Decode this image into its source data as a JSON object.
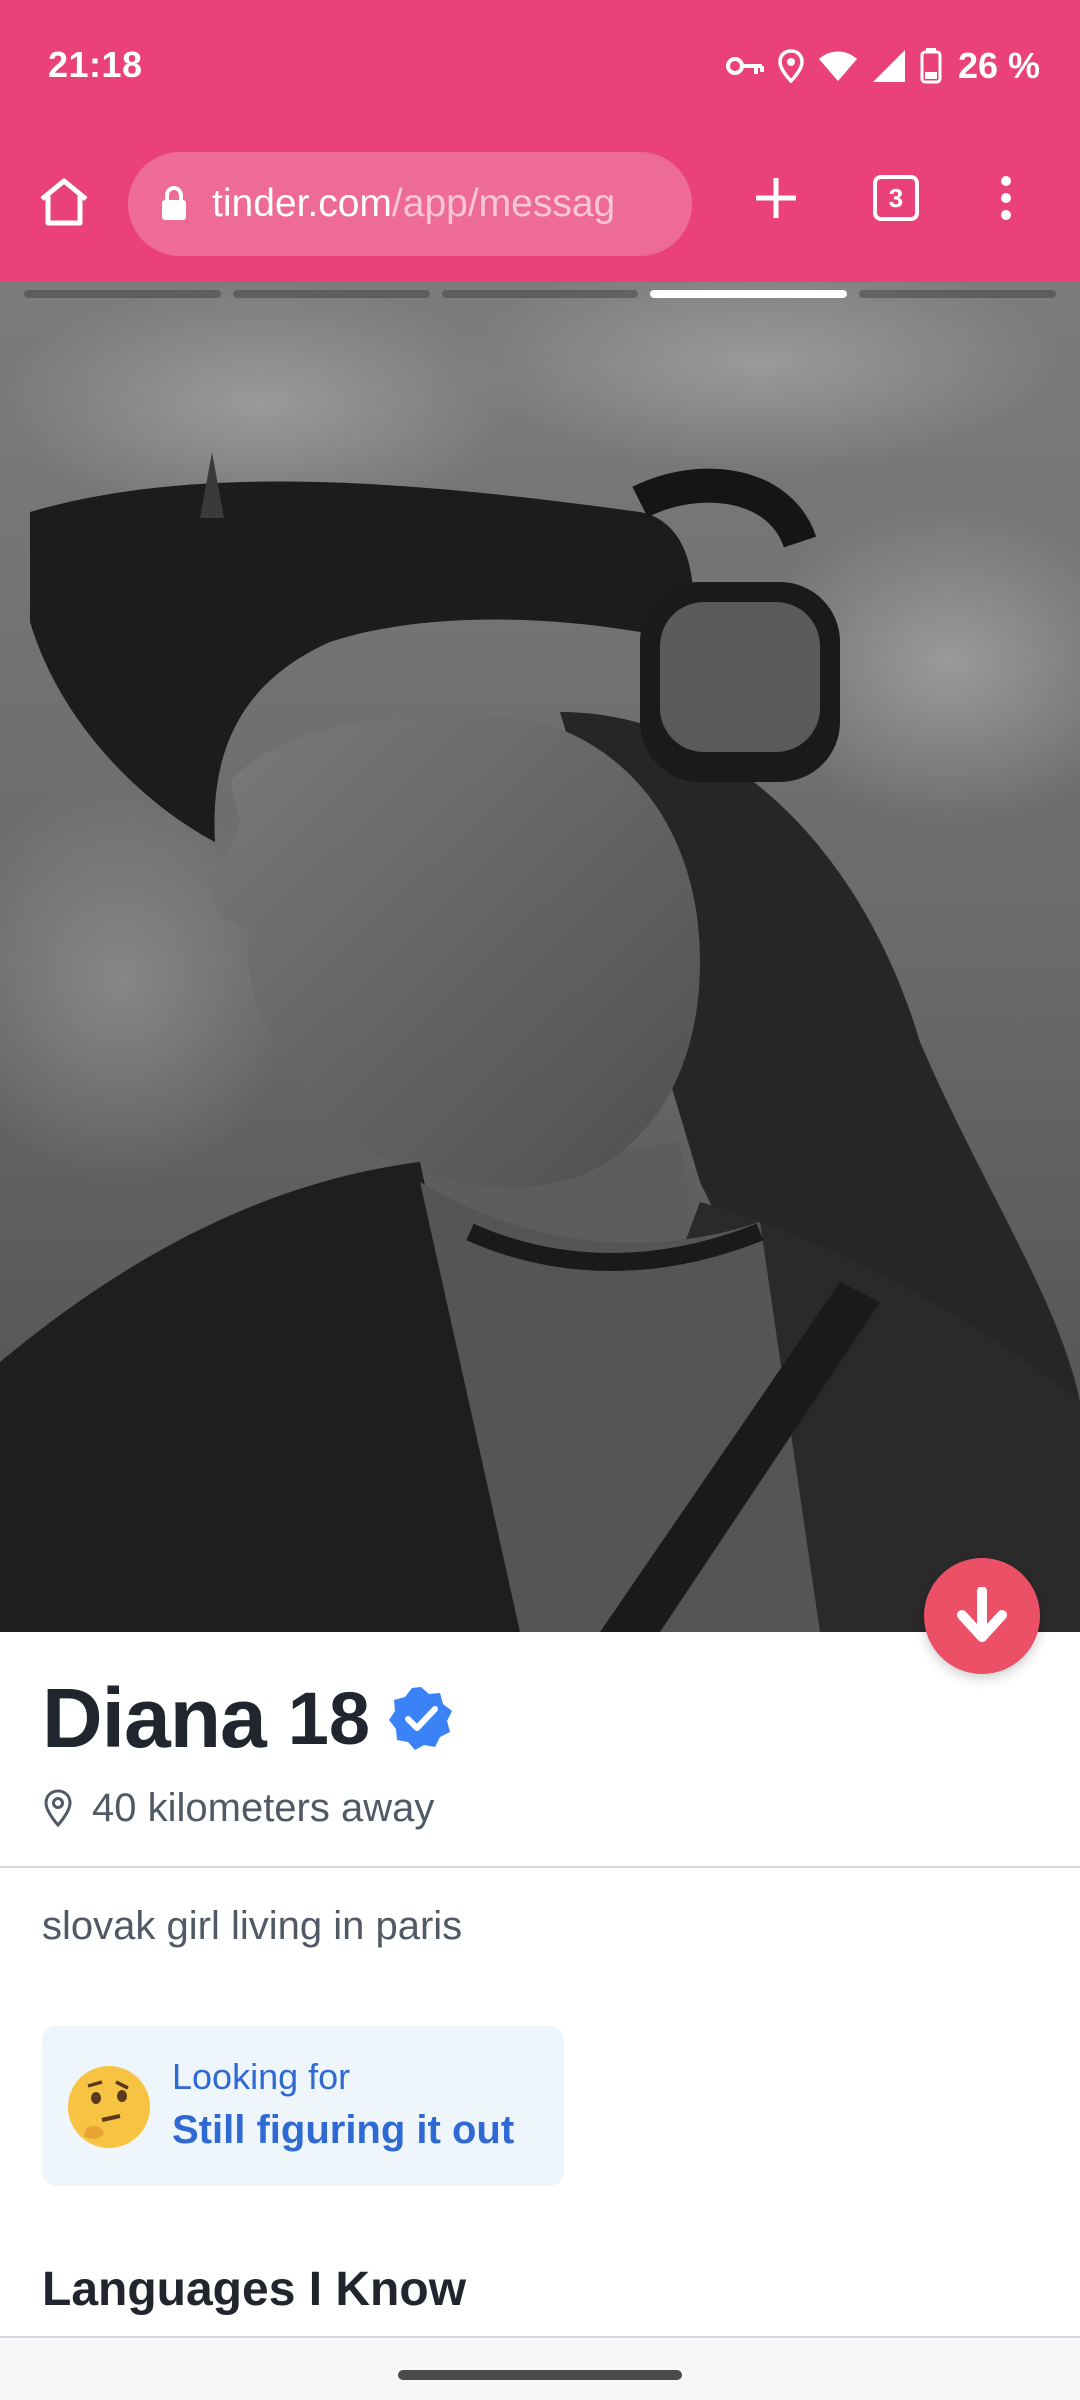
{
  "status_bar": {
    "time": "21:18",
    "battery": "26 %",
    "icons": [
      "vpn-key-icon",
      "location-icon",
      "wifi-icon",
      "signal-icon",
      "battery-icon"
    ]
  },
  "browser": {
    "url_domain": "tinder.com",
    "url_path": "/app/messag",
    "tab_count": "3",
    "icons": [
      "home-icon",
      "lock-icon",
      "plus-icon",
      "tabs-icon",
      "more-vert-icon"
    ]
  },
  "photo": {
    "progress_segments": 5,
    "active_segment": 4,
    "description_icon": "scroll-down-arrow-icon"
  },
  "profile": {
    "name": "Diana",
    "age": "18",
    "verified": true,
    "distance": "40 kilometers away",
    "bio": "slovak girl living in paris",
    "looking_for": {
      "label": "Looking for",
      "value": "Still figuring it out",
      "emoji": "thinking-face-emoji"
    },
    "languages_heading": "Languages I Know"
  },
  "colors": {
    "brand": "#ea4278",
    "accent_blue": "#2f6ad4",
    "verified_blue": "#3b82f6",
    "scroll_button": "#ec5066"
  }
}
